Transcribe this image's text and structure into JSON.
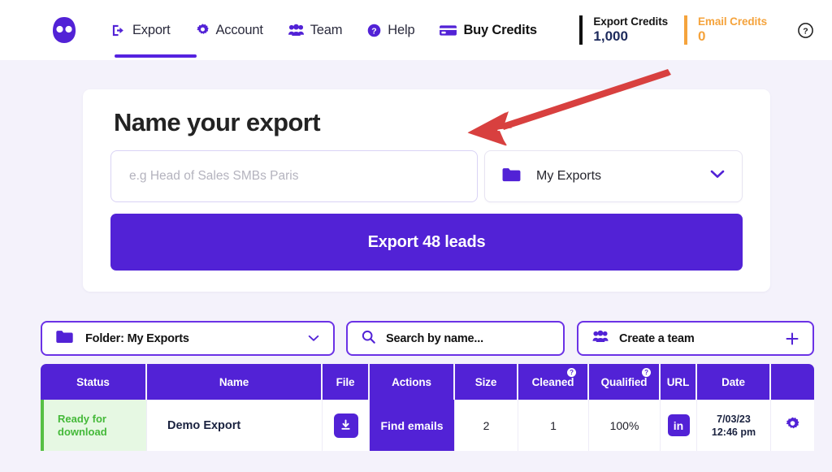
{
  "header": {
    "logo_name": "captain-data-logo",
    "nav": [
      {
        "label": "Export",
        "icon": "export-icon",
        "active": true
      },
      {
        "label": "Account",
        "icon": "gear-icon",
        "active": false
      },
      {
        "label": "Team",
        "icon": "team-icon",
        "active": false
      },
      {
        "label": "Help",
        "icon": "help-icon",
        "active": false
      },
      {
        "label": "Buy Credits",
        "icon": "credit-card-icon",
        "active": false
      }
    ],
    "credits": [
      {
        "title": "Export Credits",
        "value": "1,000",
        "color": "#1d2a5c",
        "bar": "#111111"
      },
      {
        "title": "Email Credits",
        "value": "0",
        "color": "#f5a33c",
        "bar": "#f5a33c"
      }
    ],
    "help_icon": "question-mark-circle-icon"
  },
  "export_card": {
    "title": "Name your export",
    "name_input": {
      "value": "",
      "placeholder": "e.g Head of Sales SMBs Paris"
    },
    "folder_select": {
      "label": "My Exports",
      "icon": "folder-icon",
      "chevron": "chevron-down-icon"
    },
    "export_button": "Export 48 leads"
  },
  "annotation": {
    "arrow_color": "#d8403f",
    "shape": "red-arrow"
  },
  "toolbar": {
    "folder_filter": {
      "label": "Folder: My Exports",
      "icon": "folder-icon",
      "chevron": "chevron-down-icon"
    },
    "search": {
      "placeholder": "Search by name...",
      "value": "Search by name...",
      "icon": "search-icon"
    },
    "create_team": {
      "label": "Create a team",
      "icon": "team-icon",
      "plus": "plus-icon"
    }
  },
  "table": {
    "columns": [
      {
        "label": "Status",
        "help": false
      },
      {
        "label": "Name",
        "help": false
      },
      {
        "label": "File",
        "help": false
      },
      {
        "label": "Actions",
        "help": false
      },
      {
        "label": "Size",
        "help": false
      },
      {
        "label": "Cleaned",
        "help": true
      },
      {
        "label": "Qualified",
        "help": true
      },
      {
        "label": "URL",
        "help": false
      },
      {
        "label": "Date",
        "help": false
      },
      {
        "label": "",
        "help": false
      }
    ],
    "rows": [
      {
        "status_line1": "Ready for",
        "status_line2": "download",
        "status_color": "#44b939",
        "name": "Demo Export",
        "file_icon": "download-icon",
        "action": "Find emails",
        "size": "2",
        "cleaned": "1",
        "qualified": "100%",
        "url_icon": "linkedin-icon",
        "url_label": "in",
        "date_line1": "7/03/23",
        "date_line2": "12:46 pm",
        "settings_icon": "gear-icon"
      }
    ]
  },
  "theme": {
    "purple": "#5222d6",
    "purple_border": "#6b32e6",
    "background": "#f4f2fb",
    "green": "#44b939",
    "green_bg": "#e6f8e3",
    "orange": "#f5a33c",
    "red": "#d8403f"
  }
}
